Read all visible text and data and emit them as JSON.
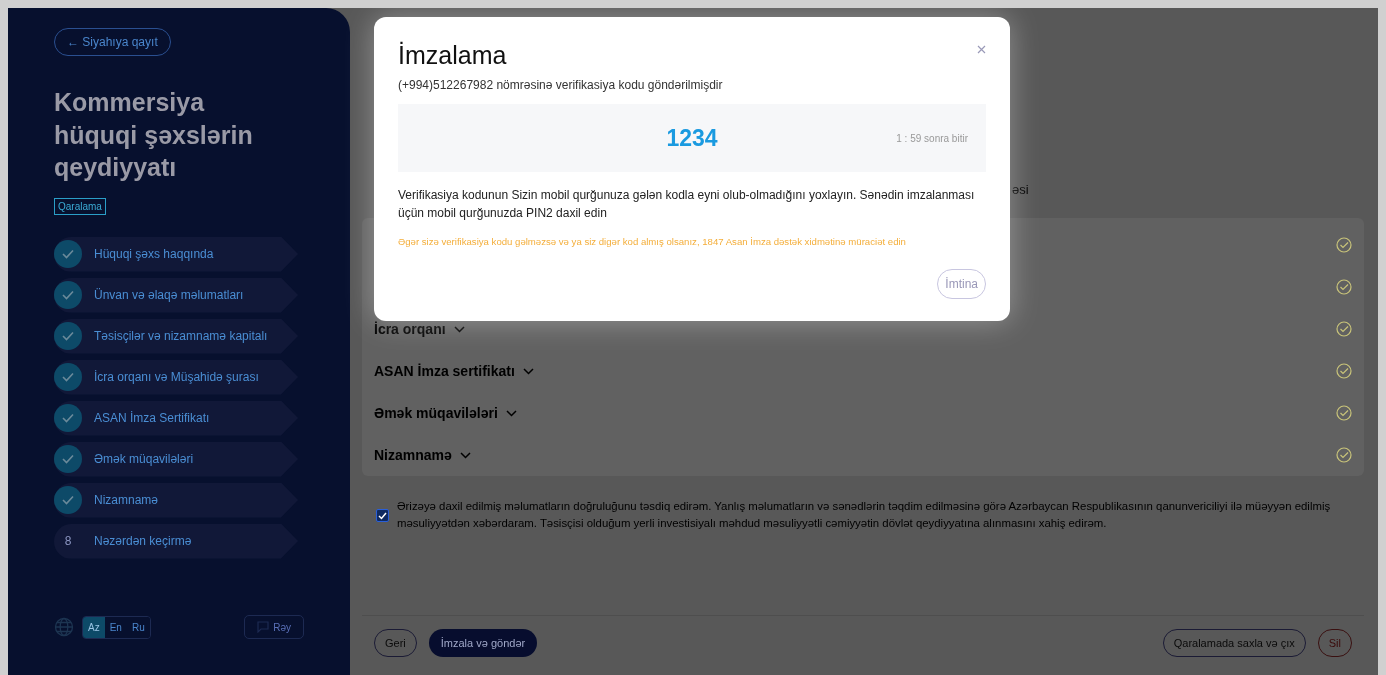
{
  "sidebar": {
    "back_link": "← Siyahıya qayıt",
    "title": "Kommersiya hüquqi şəxslərin qeydiyyatı",
    "status_badge": "Qaralama",
    "steps": [
      {
        "label": "Hüquqi şəxs haqqında",
        "done": true
      },
      {
        "label": "Ünvan və əlaqə məlumatları",
        "done": true
      },
      {
        "label": "Təsisçilər və nizamnamə kapitalı",
        "done": true
      },
      {
        "label": "İcra orqanı və Müşahidə şurası",
        "done": true
      },
      {
        "label": "ASAN İmza Sertifikatı",
        "done": true
      },
      {
        "label": "Əmək müqavilələri",
        "done": true
      },
      {
        "label": "Nizamnamə",
        "done": true
      },
      {
        "label": "Nəzərdən keçirmə",
        "done": false,
        "number": "8"
      }
    ],
    "languages": [
      {
        "label": "Az",
        "selected": true
      },
      {
        "label": "En",
        "selected": false
      },
      {
        "label": "Ru",
        "selected": false
      }
    ],
    "feedback_button": "Rəy"
  },
  "main": {
    "partial_heading": "əsi",
    "sections": [
      {
        "done": true
      },
      {
        "done": true
      },
      {
        "title": "İcra orqanı",
        "done": true
      },
      {
        "title": "ASAN İmza sertifikatı",
        "done": true
      },
      {
        "title": "Əmək müqavilələri",
        "done": true
      },
      {
        "title": "Nizamnamə",
        "done": true
      }
    ],
    "consent": {
      "checked": true,
      "text": "Ərizəyə daxil edilmiş məlumatların doğruluğunu təsdiq edirəm. Yanlış məlumatların və sənədlərin təqdim edilməsinə görə Azərbaycan Respublikasının qanunvericiliyi ilə müəyyən edilmiş məsuliyyətdən xəbərdaram. Təsisçisi olduğum yerli investisiyalı məhdud məsuliyyətli cəmiyyətin dövlət qeydiyyatına alınmasını xahiş edirəm."
    },
    "buttons": {
      "back": "Geri",
      "sign_send": "İmzala və göndər",
      "save_draft": "Qaralamada saxla və çıx",
      "delete": "Sil"
    }
  },
  "modal": {
    "title": "İmzalama",
    "subtitle": "(+994)512267982 nömrəsinə verifikasiya kodu göndərilmişdir",
    "code": "1234",
    "timer": "1 : 59 sonra bitir",
    "instructions": "Verifikasiya kodunun Sizin mobil qurğunuza gələn kodla eyni olub-olmadığını yoxlayın. Sənədin imzalanması üçün mobil qurğunuzda PIN2 daxil edin",
    "warning": "Əgər sizə verifikasiya kodu gəlməzsə və ya siz digər kod almış olsanız, 1847 Asan İmza dəstək xidmətinə müraciət edin",
    "cancel_button": "İmtina"
  }
}
